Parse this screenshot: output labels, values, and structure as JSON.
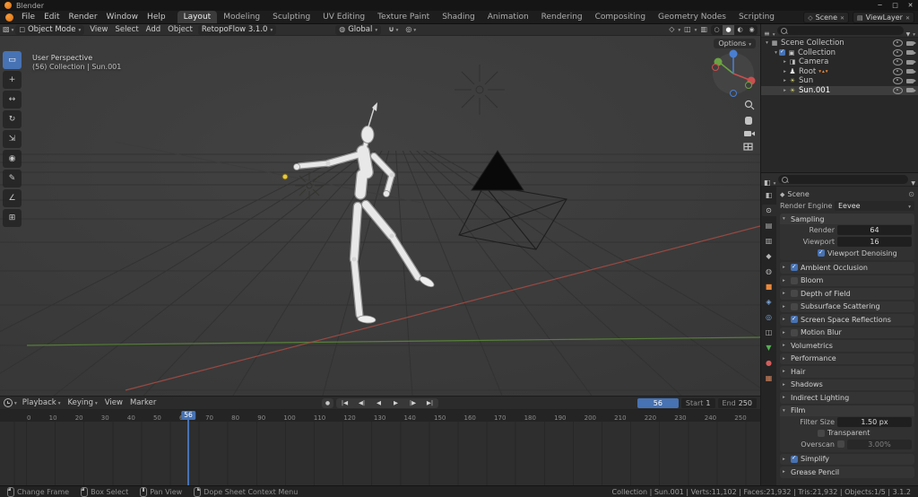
{
  "window": {
    "title": "Blender",
    "controls": [
      {
        "name": "minimize-button",
        "glyph": "─"
      },
      {
        "name": "maximize-button",
        "glyph": "□"
      },
      {
        "name": "close-button",
        "glyph": "✕"
      }
    ]
  },
  "menubar": {
    "menus": [
      {
        "label": "File"
      },
      {
        "label": "Edit"
      },
      {
        "label": "Render"
      },
      {
        "label": "Window"
      },
      {
        "label": "Help"
      }
    ],
    "workspaces": [
      {
        "label": "Layout",
        "active": true
      },
      {
        "label": "Modeling"
      },
      {
        "label": "Sculpting"
      },
      {
        "label": "UV Editing"
      },
      {
        "label": "Texture Paint"
      },
      {
        "label": "Shading"
      },
      {
        "label": "Animation"
      },
      {
        "label": "Rendering"
      },
      {
        "label": "Compositing"
      },
      {
        "label": "Geometry Nodes"
      },
      {
        "label": "Scripting"
      }
    ],
    "scene": "Scene",
    "viewlayer": "ViewLayer"
  },
  "tool_header": {
    "mode": "Object Mode",
    "menus": [
      {
        "label": "View"
      },
      {
        "label": "Select"
      },
      {
        "label": "Add"
      },
      {
        "label": "Object"
      }
    ],
    "addon": "RetopoFlow 3.1.0",
    "orientation": "Global",
    "options": "Options"
  },
  "viewport": {
    "overlay_line1": "User Perspective",
    "overlay_line2": "(56) Collection | Sun.001",
    "tools": [
      {
        "tool": "tool-select-box",
        "name": "select-box-tool",
        "active": true
      },
      {
        "tool": "tool-cursor",
        "name": "cursor-tool"
      },
      {
        "tool": "tool-move",
        "name": "move-tool"
      },
      {
        "tool": "tool-rotate",
        "name": "rotate-tool"
      },
      {
        "tool": "tool-scale",
        "name": "scale-tool"
      },
      {
        "tool": "tool-transform",
        "name": "transform-tool"
      },
      {
        "tool": "tool-annotate",
        "name": "annotate-tool"
      },
      {
        "tool": "tool-measure",
        "name": "measure-tool"
      },
      {
        "tool": "tool-add-cube",
        "name": "add-cube-tool"
      }
    ]
  },
  "outliner": {
    "search_placeholder": "",
    "rows": [
      {
        "label": "Scene Collection",
        "icon": "scene-collection",
        "iconname": "scene-collection-icon",
        "ind": "d0",
        "arrow": "▾"
      },
      {
        "label": "Collection",
        "icon": "collection",
        "iconname": "collection-icon",
        "ind": "d1",
        "arrow": "▾",
        "checkbox": true
      },
      {
        "label": "Camera",
        "icon": "camera",
        "iconname": "camera-icon",
        "ind": "d2",
        "arrow": "▸"
      },
      {
        "label": "Root",
        "icon": "armature",
        "iconname": "armature-icon",
        "ind": "d2",
        "arrow": "▸",
        "extras": "▾▴▾"
      },
      {
        "label": "Sun",
        "icon": "light",
        "iconname": "light-icon",
        "ind": "d2",
        "arrow": "▸"
      },
      {
        "label": "Sun.001",
        "icon": "light",
        "iconname": "light-icon",
        "ind": "d2",
        "arrow": "▸",
        "active": true
      }
    ]
  },
  "properties": {
    "search_placeholder": "",
    "tabs": [
      {
        "tab": "tab-tool"
      },
      {
        "tab": "tab-render",
        "active": true
      },
      {
        "tab": "tab-output"
      },
      {
        "tab": "tab-view-layer"
      },
      {
        "tab": "tab-scene"
      },
      {
        "tab": "tab-world"
      },
      {
        "tab": "tab-object"
      },
      {
        "tab": "tab-modifiers"
      },
      {
        "tab": "tab-physics"
      },
      {
        "tab": "tab-constraints"
      },
      {
        "tab": "tab-data"
      },
      {
        "tab": "tab-material"
      },
      {
        "tab": "tab-texture"
      }
    ],
    "breadcrumb": "Scene",
    "engine_label": "Render Engine",
    "engine_value": "Eevee",
    "sampling": {
      "arrow": "▾",
      "title": "Sampling",
      "render_label": "Render",
      "render_value": "64",
      "viewport_label": "Viewport",
      "viewport_value": "16",
      "denoising_label": "Viewport Denoising"
    },
    "sections": [
      {
        "arrow": "▸",
        "label": "Ambient Occlusion",
        "cb": "on"
      },
      {
        "arrow": "▸",
        "label": "Bloom",
        "cb": "off"
      },
      {
        "arrow": "▸",
        "label": "Depth of Field",
        "cb": "off"
      },
      {
        "arrow": "▸",
        "label": "Subsurface Scattering",
        "cb": "off"
      },
      {
        "arrow": "▸",
        "label": "Screen Space Reflections",
        "cb": "on"
      },
      {
        "arrow": "▸",
        "label": "Motion Blur",
        "cb": "off"
      },
      {
        "arrow": "▸",
        "label": "Volumetrics",
        "cb": "none"
      },
      {
        "arrow": "▸",
        "label": "Performance",
        "cb": "none"
      },
      {
        "arrow": "▸",
        "label": "Hair",
        "cb": "none"
      },
      {
        "arrow": "▸",
        "label": "Shadows",
        "cb": "none"
      },
      {
        "arrow": "▸",
        "label": "Indirect Lighting",
        "cb": "none"
      }
    ],
    "film": {
      "arrow": "▾",
      "title": "Film",
      "filter_label": "Filter Size",
      "filter_value": "1.50 px",
      "transparent_label": "Transparent",
      "overscan_label": "Overscan",
      "overscan_value": "3.00%"
    },
    "simplify": {
      "arrow": "▸",
      "label": "Simplify"
    },
    "grease_pencil": {
      "arrow": "▸",
      "label": "Grease Pencil"
    }
  },
  "timeline": {
    "menus": [
      {
        "label": "Playback",
        "caret": true
      },
      {
        "label": "Keying",
        "caret": true
      },
      {
        "label": "View"
      },
      {
        "label": "Marker"
      }
    ],
    "transport": [
      {
        "icon": "jump-start",
        "name": "jump-to-start-button"
      },
      {
        "icon": "prev-key",
        "name": "previous-keyframe-button"
      },
      {
        "icon": "play-back",
        "name": "play-reverse-button"
      },
      {
        "icon": "play",
        "name": "play-button"
      },
      {
        "icon": "next-key",
        "name": "next-keyframe-button"
      },
      {
        "icon": "jump-end",
        "name": "jump-to-end-button"
      }
    ],
    "current_frame": "56",
    "start_label": "Start",
    "start_value": "1",
    "end_label": "End",
    "end_value": "250",
    "ticks": [
      "0",
      "10",
      "20",
      "30",
      "40",
      "50",
      "60",
      "70",
      "80",
      "90",
      "100",
      "110",
      "120",
      "130",
      "140",
      "150",
      "160",
      "170",
      "180",
      "190",
      "200",
      "210",
      "220",
      "230",
      "240",
      "250"
    ]
  },
  "statusbar": {
    "hints": [
      {
        "button": "left",
        "label": "Change Frame"
      },
      {
        "button": "left",
        "label": "Box Select"
      },
      {
        "button": "middle",
        "label": "Pan View"
      },
      {
        "button": "right",
        "label": "Dope Sheet Context Menu"
      }
    ],
    "stats": "Collection | Sun.001 | Verts:11,102 | Faces:21,932 | Tris:21,932 | Objects:1/5 | 3.1.2"
  },
  "colors": {
    "accent": "#4772b3",
    "axis_x": "#a84c44",
    "axis_y": "#5c8b39",
    "selected_light": "#e7c93e"
  }
}
